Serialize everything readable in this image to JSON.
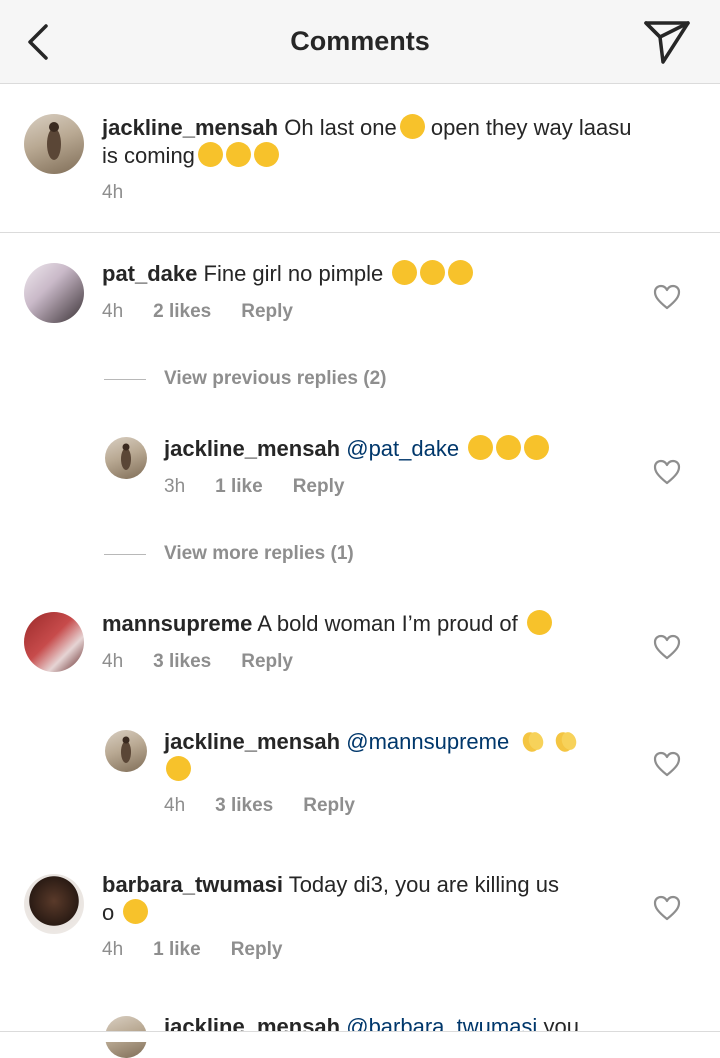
{
  "header": {
    "title": "Comments"
  },
  "caption": {
    "user": "jackline_mensah",
    "text_a": "Oh last one",
    "text_b": "open they way laasu",
    "text_c": "is coming",
    "time": "4h"
  },
  "comments": [
    {
      "user": "pat_dake",
      "text": "Fine girl no pimple",
      "time": "4h",
      "likes": "2 likes",
      "reply": "Reply",
      "view_replies": "View previous replies (2)",
      "reply_item": {
        "user": "jackline_mensah",
        "mention": "@pat_dake",
        "time": "3h",
        "likes": "1 like",
        "reply": "Reply"
      },
      "more_replies": "View more replies (1)"
    },
    {
      "user": "mannsupreme",
      "text": "A bold woman I’m proud of",
      "time": "4h",
      "likes": "3 likes",
      "reply": "Reply",
      "reply_item": {
        "user": "jackline_mensah",
        "mention": "@mannsupreme",
        "time": "4h",
        "likes": "3 likes",
        "reply": "Reply"
      }
    },
    {
      "user": "barbara_twumasi",
      "text": "Today di3, you are killing us",
      "text_cont": "o",
      "time": "4h",
      "likes": "1 like",
      "reply": "Reply",
      "reply_item": {
        "user": "jackline_mensah",
        "mention": "@barbara_twumasi",
        "text": "you"
      }
    }
  ],
  "icons": {
    "back": "chevron-left-icon",
    "send": "paper-plane-icon",
    "like": "heart-outline-icon"
  },
  "colors": {
    "username": "#262626",
    "mention": "#00376b",
    "meta": "#8e8e8e",
    "header_bg": "#f6f6f6"
  }
}
